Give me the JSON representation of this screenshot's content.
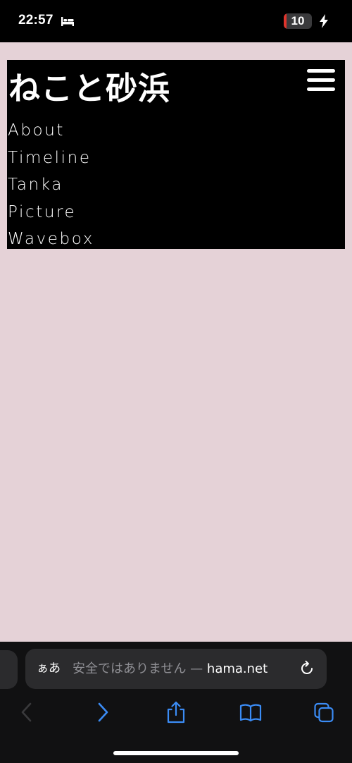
{
  "status_bar": {
    "time": "22:57",
    "battery_level": "10",
    "battery_color": "#e0342c",
    "icons": [
      "bed-icon",
      "charging-bolt-icon"
    ]
  },
  "site": {
    "title": "ねこと砂浜",
    "menu_icon": "hamburger-menu-icon",
    "nav": [
      {
        "label": "About"
      },
      {
        "label": "Timeline"
      },
      {
        "label": "Tanka"
      },
      {
        "label": "Picture"
      },
      {
        "label": "Wavebox"
      }
    ],
    "background_color": "#e5d2d7",
    "header_color": "#000000"
  },
  "browser": {
    "aa_label": "ぁあ",
    "url_warning": "安全ではありません — ",
    "url_domain_partial": "hama.net",
    "accent_color": "#3b8cf5",
    "toolbar_icons": [
      "back-icon",
      "forward-icon",
      "share-icon",
      "bookmarks-icon",
      "tabs-icon",
      "reload-icon"
    ]
  }
}
